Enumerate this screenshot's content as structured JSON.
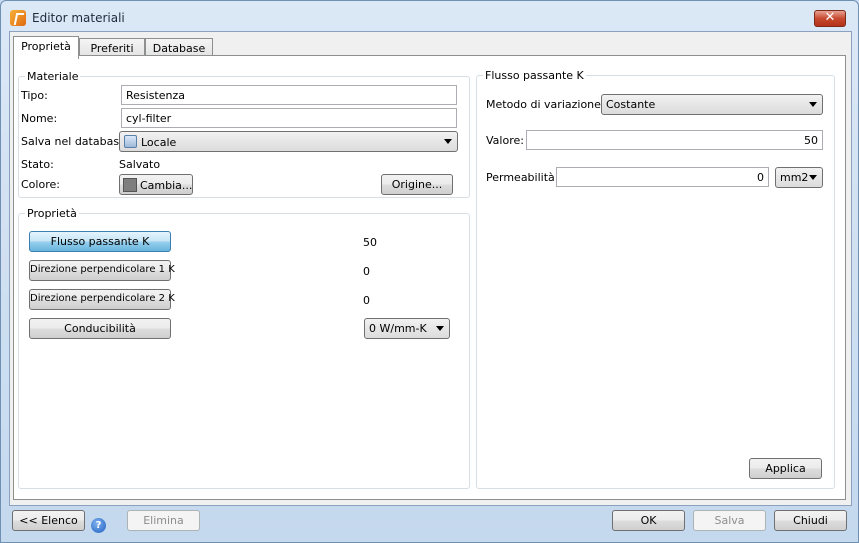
{
  "window": {
    "title": "Editor materiali"
  },
  "tabs": [
    {
      "label": "Proprietà"
    },
    {
      "label": "Preferiti"
    },
    {
      "label": "Database"
    }
  ],
  "materiale": {
    "group_title": "Materiale",
    "tipo_label": "Tipo:",
    "tipo_value": "Resistenza",
    "nome_label": "Nome:",
    "nome_value": "cyl-filter",
    "salva_label": "Salva nel database:",
    "salva_value": "Locale",
    "stato_label": "Stato:",
    "stato_value": "Salvato",
    "colore_label": "Colore:",
    "cambia_label": "Cambia...",
    "origine_label": "Origine..."
  },
  "proprieta": {
    "group_title": "Proprietà",
    "rows": [
      {
        "button": "Flusso passante K",
        "value": "50"
      },
      {
        "button": "Direzione perpendicolare 1 K",
        "value": "0"
      },
      {
        "button": "Direzione perpendicolare 2 K",
        "value": "0"
      },
      {
        "button": "Conducibilità",
        "value": "0 W/mm-K"
      }
    ]
  },
  "flusso": {
    "group_title": "Flusso passante K",
    "metodo_label": "Metodo di variazione:",
    "metodo_value": "Costante",
    "valore_label": "Valore:",
    "valore_value": "50",
    "permeabilita_label": "Permeabilità:",
    "permeabilita_value": "0",
    "permeabilita_unit": "mm2",
    "applica_label": "Applica"
  },
  "footer": {
    "elenco_label": "<< Elenco",
    "elimina_label": "Elimina",
    "ok_label": "OK",
    "salva_label": "Salva",
    "chiudi_label": "Chiudi"
  }
}
